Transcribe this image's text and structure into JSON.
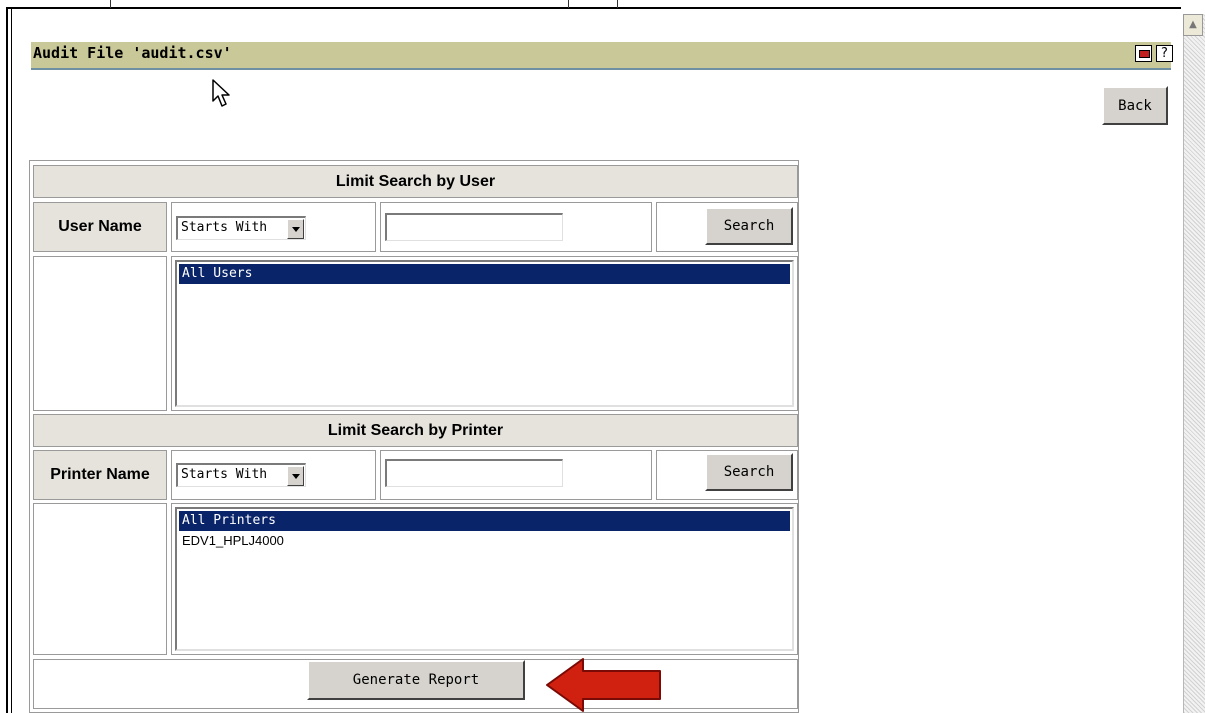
{
  "page": {
    "title": "Audit File 'audit.csv'",
    "back_label": "Back"
  },
  "user_section": {
    "header": "Limit Search by User",
    "label": "User Name",
    "match_mode": "Starts With",
    "search_value": "",
    "search_label": "Search",
    "list_items": [
      {
        "label": "All Users",
        "selected": true
      }
    ]
  },
  "printer_section": {
    "header": "Limit Search by Printer",
    "label": "Printer Name",
    "match_mode": "Starts With",
    "search_value": "",
    "search_label": "Search",
    "list_items": [
      {
        "label": "All Printers",
        "selected": true
      },
      {
        "label": "EDV1_HPLJ4000",
        "selected": false
      }
    ]
  },
  "footer": {
    "generate_label": "Generate Report"
  },
  "icons": {
    "printer": "printer-icon",
    "help": "help-icon",
    "cursor": "mouse-cursor",
    "annotation_arrow": "red-arrow"
  },
  "colors": {
    "title_bar": "#c9c898",
    "selection": "#0a246a",
    "annotation_arrow": "#d02010"
  }
}
